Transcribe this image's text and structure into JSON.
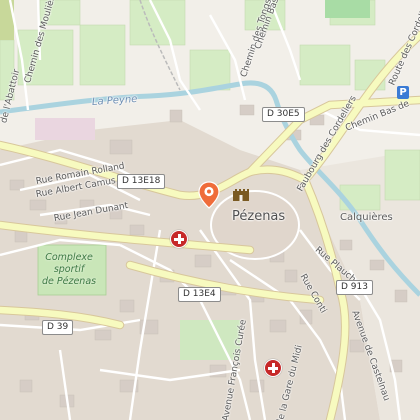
{
  "map": {
    "town": "Pézenas",
    "places": {
      "calquieres": "Calquières"
    },
    "water": {
      "peyne": "La Peyne"
    },
    "green_areas": {
      "complexe_line1": "Complexe",
      "complexe_line2": "sportif",
      "complexe_line3": "de Pézenas"
    },
    "streets": {
      "chemin_moulieres": "Chemin des Moulières",
      "abattoir": "de l'Abattoir",
      "chemin_tongs": "Chemin des Tongs",
      "chemin_bas": "Chemin Bas",
      "chemin_bas2": "Chemin Bas de",
      "route_cordeliers": "Route des Cordeliers",
      "faubourg_cordeliers": "Faubourg des Cordeliers",
      "romain_rolland": "Rue Romain Rolland",
      "albert_camus": "Rue Albert Camus",
      "jean_dunant": "Rue Jean Dunant",
      "rue_plauche": "Rue Plauche",
      "rue_conti": "Rue Conti",
      "avenue_castelnau": "Avenue de Castelnau",
      "avenue_francois_curee": "Avenue François Curée",
      "gare_du_midi": "de la Gare du Midi"
    },
    "road_shields": {
      "d30e5": "D 30E5",
      "d13e18": "D 13E18",
      "d13e4": "D 13E4",
      "d39": "D 39",
      "d913": "D 913"
    },
    "icons": {
      "location_pin": "map-marker-icon",
      "monument": "castle-icon",
      "pharmacy": "pharmacy-icon",
      "parking": "parking-icon",
      "parking_letter": "P"
    },
    "colors": {
      "background": "#f2efe9",
      "built_area": "#e2dad0",
      "buildings": "#d9d0c9",
      "fields": "#d5ecc4",
      "river": "#aad3df",
      "road_major": "#f7fabf",
      "pin": "#ef6c3a",
      "pharmacy": "#c62828"
    }
  }
}
